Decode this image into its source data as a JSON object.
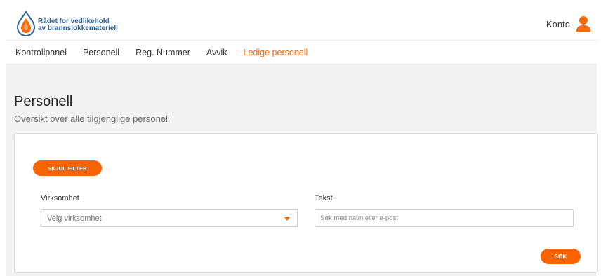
{
  "brand": {
    "name_line1": "Rådet for vedlikehold",
    "name_line2": "av brannslokkemateriell",
    "colors": {
      "blue": "#2f5f8e",
      "orange": "#f26b14"
    }
  },
  "header": {
    "account_label": "Konto",
    "account_icon": "user-icon"
  },
  "nav": {
    "items": [
      {
        "label": "Kontrollpanel",
        "active": false
      },
      {
        "label": "Personell",
        "active": false
      },
      {
        "label": "Reg. Nummer",
        "active": false
      },
      {
        "label": "Avvik",
        "active": false
      },
      {
        "label": "Ledige personell",
        "active": true
      }
    ]
  },
  "page": {
    "title": "Personell",
    "subtitle": "Oversikt over alle tilgjenglige personell"
  },
  "filter": {
    "toggle_label": "SKJUL FILTER",
    "company_label": "Virksomhet",
    "company_placeholder": "Velg virksomhet",
    "text_label": "Tekst",
    "text_placeholder": "Søk med navn eller e-post",
    "search_label": "SØK"
  },
  "colors": {
    "accent": "#fa6400",
    "background": "#f2f2f2"
  }
}
